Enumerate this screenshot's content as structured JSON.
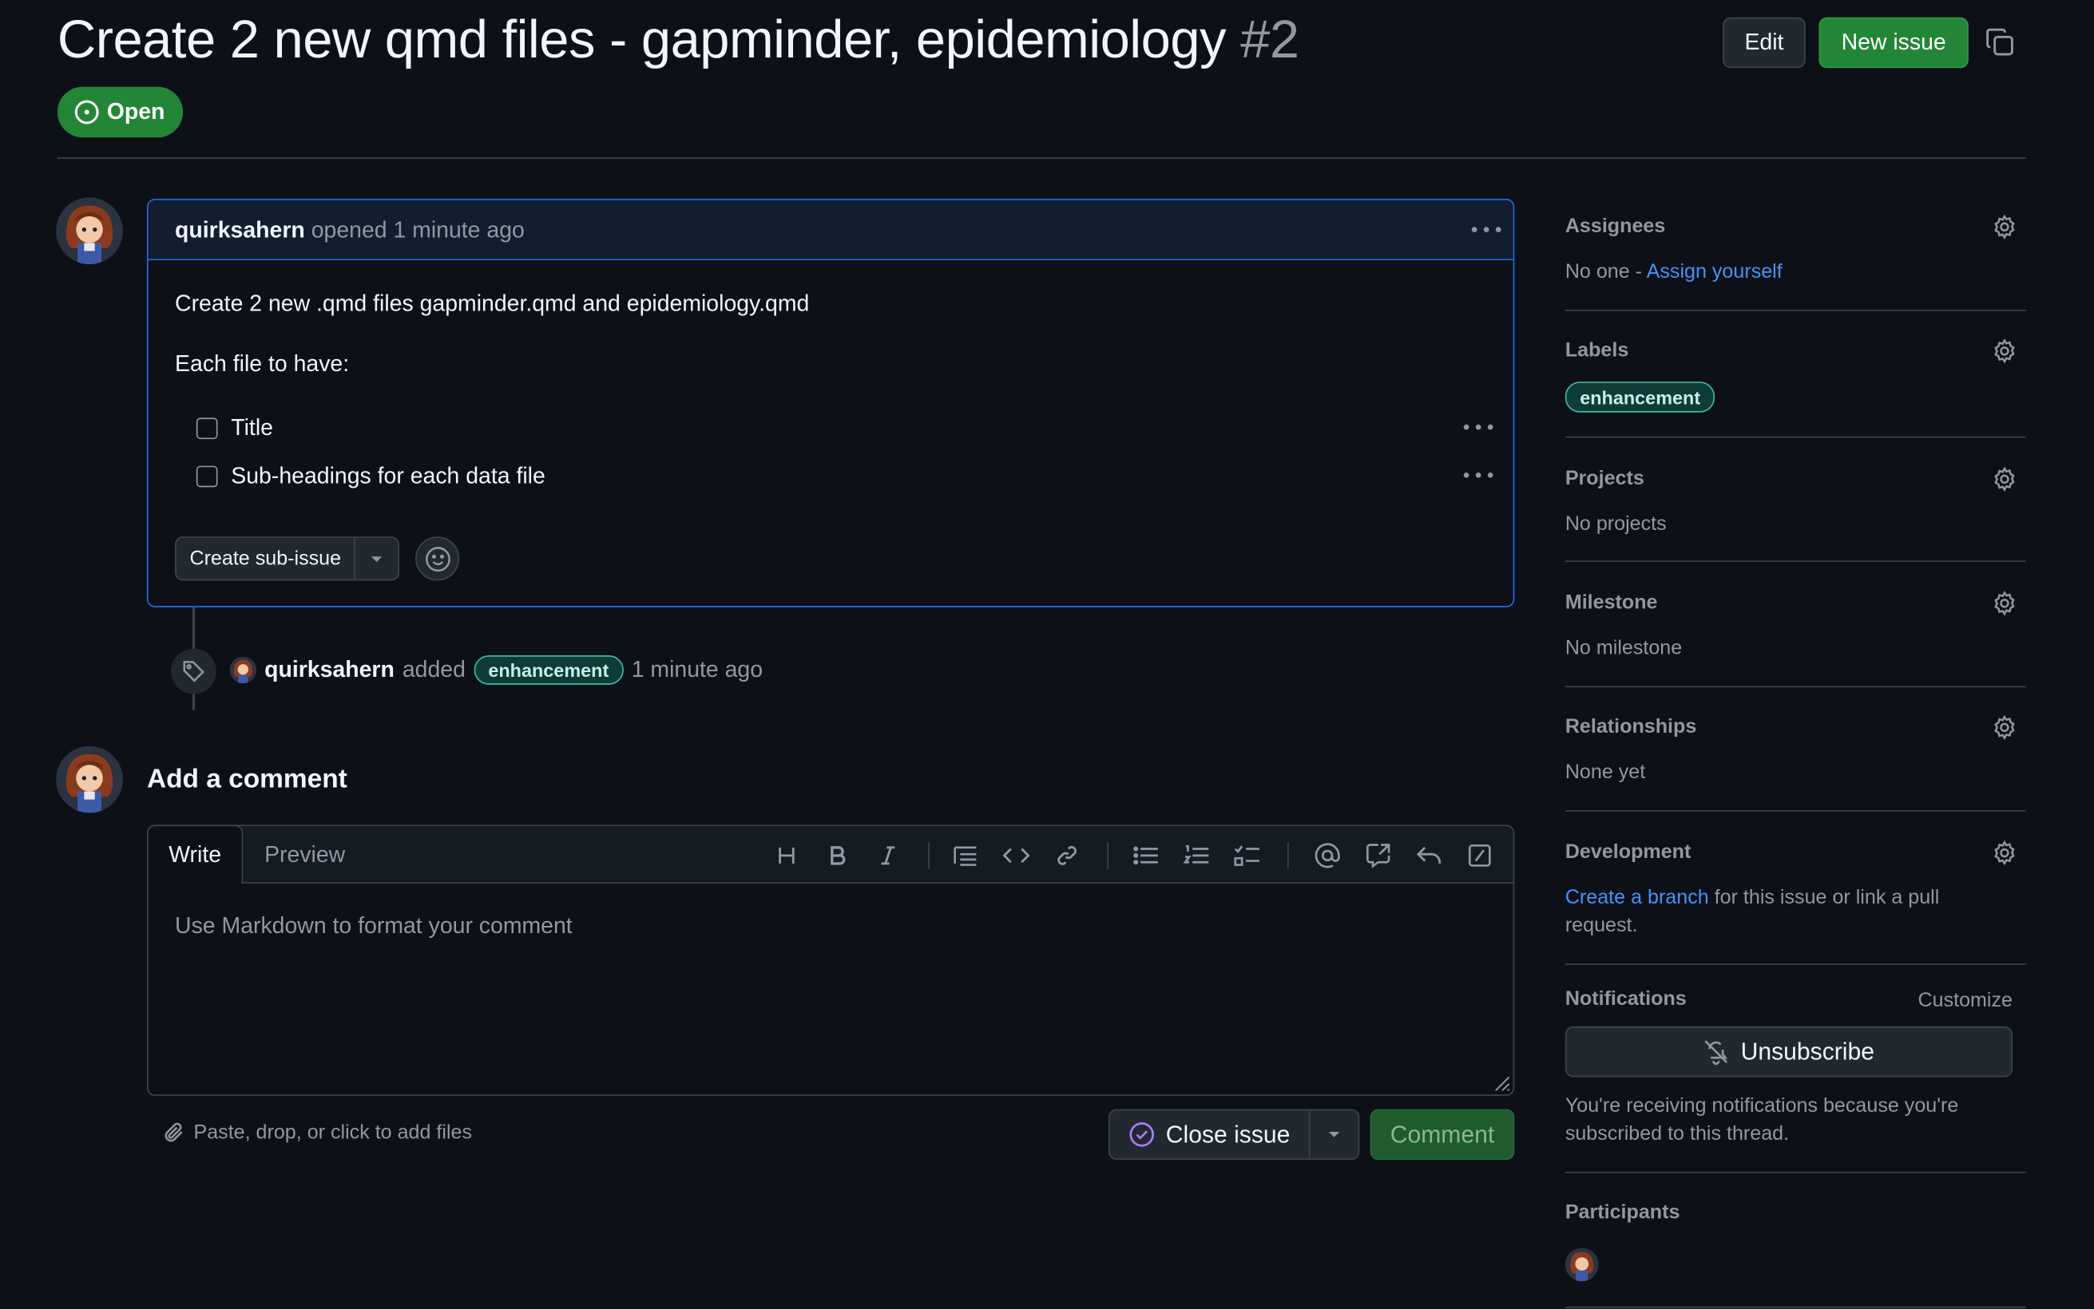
{
  "issue": {
    "title": "Create 2 new qmd files - gapminder, epidemiology",
    "number": "#2",
    "state": "Open"
  },
  "header": {
    "edit_label": "Edit",
    "new_issue_label": "New issue"
  },
  "comment": {
    "author": "quirksahern",
    "action": "opened 1 minute ago",
    "line1": "Create 2 new .qmd files gapminder.qmd and epidemiology.qmd",
    "line2": "Each file to have:",
    "tasks": [
      {
        "label": "Title",
        "checked": false
      },
      {
        "label": "Sub-headings for each data file",
        "checked": false
      }
    ],
    "create_sub_issue_label": "Create sub-issue"
  },
  "timeline_event": {
    "author": "quirksahern",
    "action": "added",
    "label": "enhancement",
    "time": "1 minute ago"
  },
  "add_comment": {
    "title": "Add a comment",
    "tab_write": "Write",
    "tab_preview": "Preview",
    "placeholder": "Use Markdown to format your comment",
    "attach_text": "Paste, drop, or click to add files",
    "close_issue_label": "Close issue",
    "comment_label": "Comment",
    "toolbar_icons": [
      "heading-icon",
      "bold-icon",
      "italic-icon",
      "quote-icon",
      "code-icon",
      "link-icon",
      "bulleted-list-icon",
      "numbered-list-icon",
      "task-list-icon",
      "mention-icon",
      "reference-icon",
      "saved-reply-icon",
      "slash-command-icon"
    ]
  },
  "sidebar": {
    "assignees": {
      "title": "Assignees",
      "value": "No one -",
      "link": "Assign yourself"
    },
    "labels": {
      "title": "Labels",
      "label": "enhancement"
    },
    "projects": {
      "title": "Projects",
      "value": "No projects"
    },
    "milestone": {
      "title": "Milestone",
      "value": "No milestone"
    },
    "relationships": {
      "title": "Relationships",
      "value": "None yet"
    },
    "development": {
      "title": "Development",
      "link": "Create a branch",
      "text1": " for this issue or link a pull",
      "text2": "request."
    },
    "notifications": {
      "title": "Notifications",
      "customize": "Customize",
      "unsubscribe": "Unsubscribe",
      "reason1": "You're receiving notifications because you're",
      "reason2": "subscribed to this thread."
    },
    "participants": {
      "title": "Participants"
    }
  },
  "colors": {
    "background": "#0d1117",
    "open_green": "#238636",
    "link_blue": "#4493f8",
    "highlight_border": "#1f6feb",
    "label_teal": "#3fb9a0"
  }
}
